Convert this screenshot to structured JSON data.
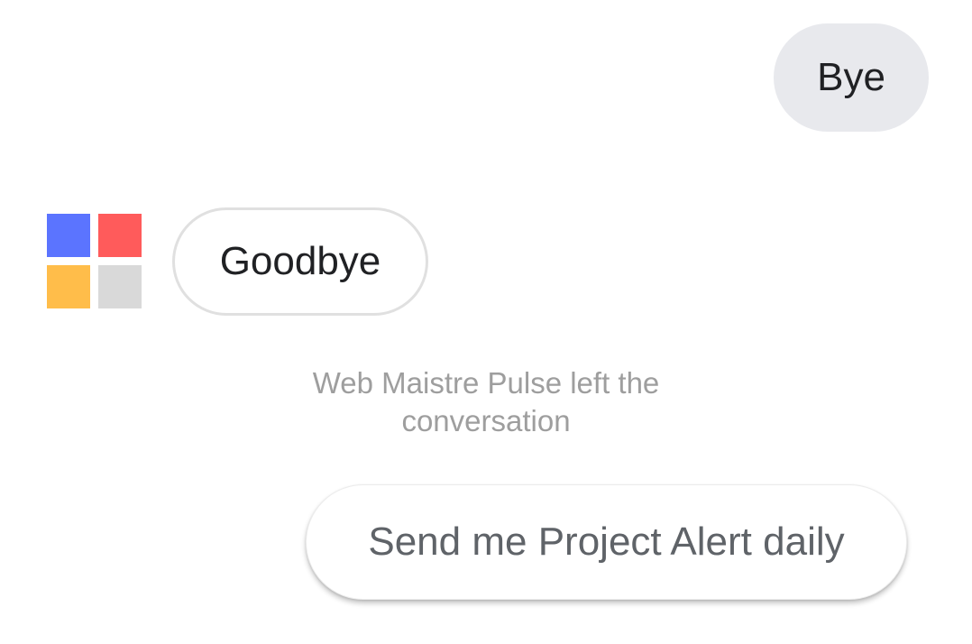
{
  "conversation": {
    "user_message": {
      "text": "Bye"
    },
    "bot_message": {
      "text": "Goodbye",
      "avatar": {
        "icon": "four-square-logo-icon",
        "colors": {
          "top_left": "#5b74ff",
          "top_right": "#ff5b5b",
          "bottom_left": "#ffbd4a",
          "bottom_right": "#d9d9d9"
        }
      }
    },
    "system_notice": {
      "line1": "Web Maistre Pulse left the",
      "line2": "conversation"
    }
  },
  "suggestion_chip": {
    "label": "Send me Project Alert daily"
  }
}
